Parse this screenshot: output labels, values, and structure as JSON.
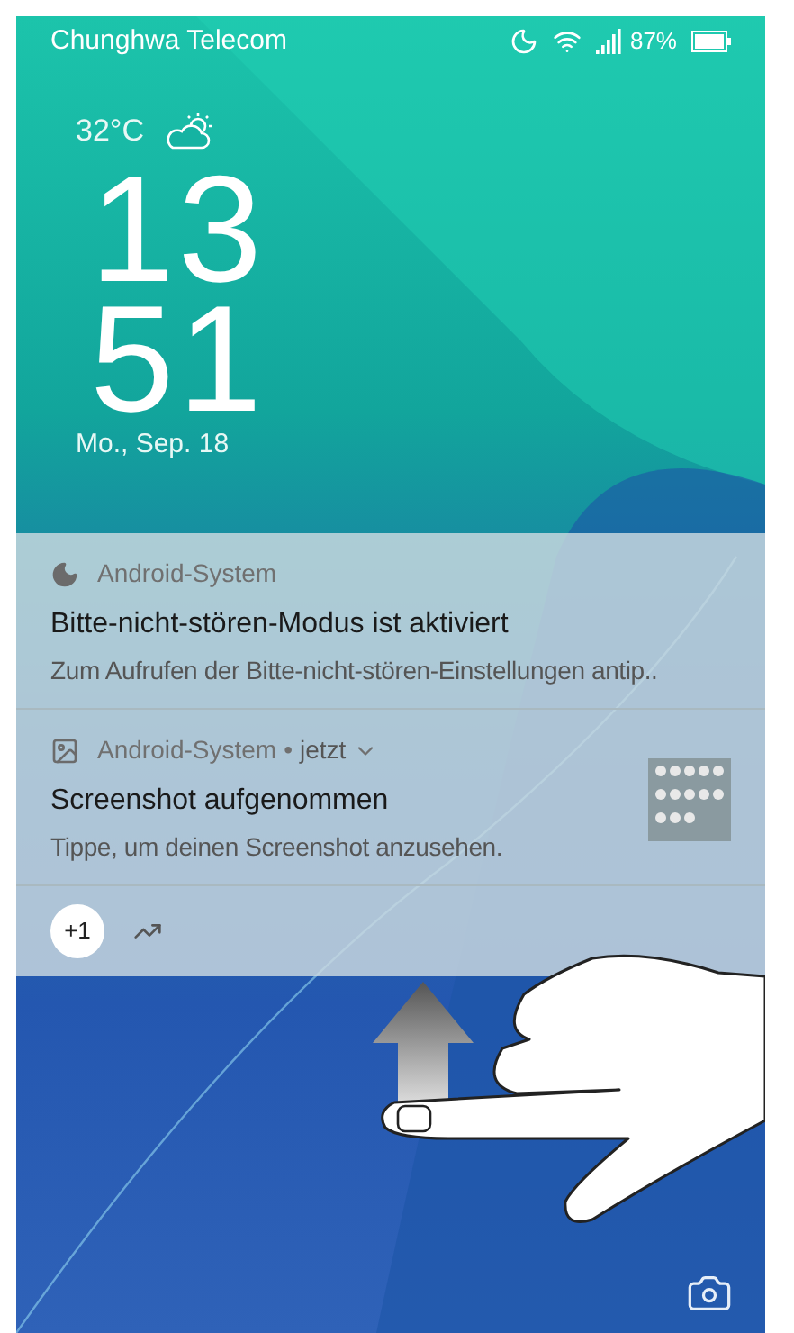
{
  "status_bar": {
    "carrier": "Chunghwa Telecom",
    "battery": "87%"
  },
  "clock": {
    "temperature": "32°C",
    "hour": "13",
    "minute": "51",
    "date": "Mo., Sep. 18"
  },
  "notifications": [
    {
      "kind": "dnd",
      "app": "Android-System",
      "title": "Bitte-nicht-stören-Modus ist aktiviert",
      "text": "Zum Aufrufen der Bitte-nicht-stören-Einstellungen antip.."
    },
    {
      "kind": "screenshot",
      "app": "Android-System",
      "separator": "•",
      "time": "jetzt",
      "title": "Screenshot aufgenommen",
      "text": "Tippe, um deinen Screenshot anzusehen."
    }
  ],
  "notification_footer": {
    "more_count": "+1"
  }
}
